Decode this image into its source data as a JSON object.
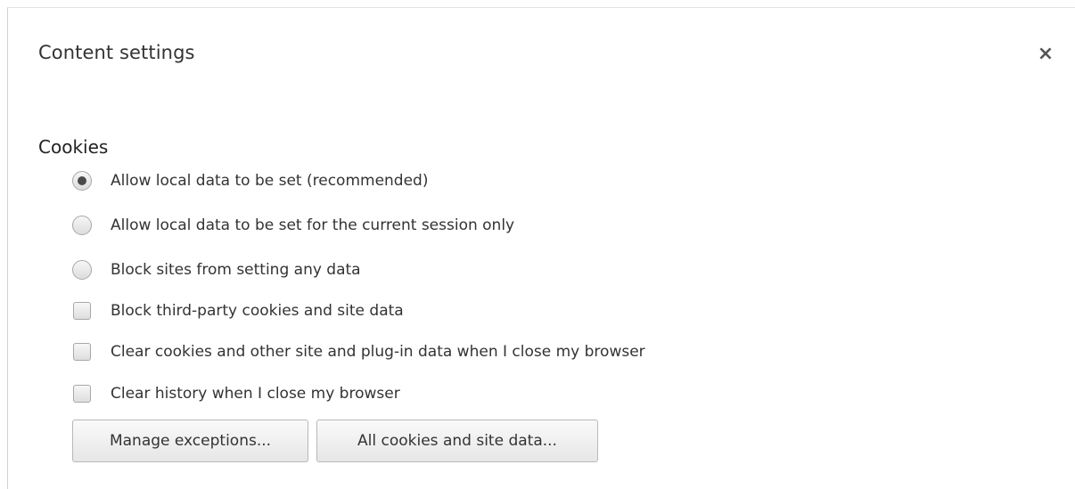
{
  "dialog": {
    "title": "Content settings",
    "close_symbol": "×"
  },
  "cookies": {
    "heading": "Cookies",
    "radio_options": [
      {
        "label": "Allow local data to be set (recommended)",
        "selected": true
      },
      {
        "label": "Allow local data to be set for the current session only",
        "selected": false
      },
      {
        "label": "Block sites from setting any data",
        "selected": false
      }
    ],
    "checkbox_options": [
      {
        "label": "Block third-party cookies and site data",
        "checked": false
      },
      {
        "label": "Clear cookies and other site and plug-in data when I close my browser",
        "checked": false
      },
      {
        "label": "Clear history when I close my browser",
        "checked": false
      }
    ],
    "buttons": {
      "manage_exceptions": "Manage exceptions...",
      "all_cookies": "All cookies and site data..."
    }
  },
  "icons": {
    "close": "close-icon"
  }
}
